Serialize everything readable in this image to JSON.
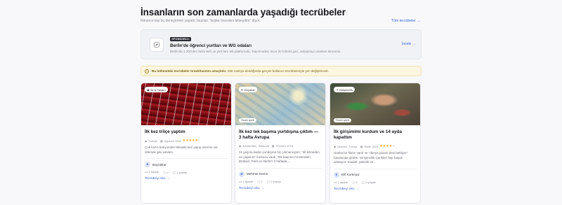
{
  "header": {
    "title": "İnsanların son zamanlarda yaşadığı tecrübeler",
    "subtitle": "Rimerce kişi bu deneyimleri yaşadı; bazıları \"keşke önceden bilseydim\" diyor.",
    "all_link": "Tüm tecrübeler →"
  },
  "sponsor": {
    "badge": "SPONSORLU",
    "title": "Berlin'de öğrenci yurtları ve WG odaları",
    "description": "Berlin'da 1.200'den fazla WG ve yurt fanı tek platformda. Taşınmadan önce 30 fotlarla gez, anlaşmayı uzaktan tamamla.",
    "link": "İncele →",
    "icon": "compass-icon"
  },
  "notice": {
    "icon": "info-icon",
    "bold": "Bu bölümdeki tecrübeler örnek/tanıtım amaçlıdır.",
    "text": " Site canlıya alındığında gerçek kullanıcı tecrübeleriyle yer değiştirecek."
  },
  "cards": [
    {
      "tag": "İlk İş Yaşam",
      "title": "İlk kez trilçe yaptım",
      "location": "Türkiye",
      "date": "Ağustos 2026",
      "rating": 5,
      "description": "Çok kazılı kanyondan Menalis kez yapıp üzerme sıtl dökmek gibi sanden",
      "author": "Bayraktar",
      "avatar": "B",
      "likes": "2 faydalı",
      "comments": "0",
      "saves": "1 yaşadı",
      "read": "Tecrübeyi oku →"
    },
    {
      "tag": "Seyahat",
      "example": "Örnek içerik",
      "title": "İlk kez tek başıma yurtdışına çıktım — 3 hafta Avrupa",
      "location": "Amsterdam, Hollanda",
      "date": "Temmuz 2016",
      "rating": 5,
      "description": "31 yaşına kadar yurtdışına hiç çıkmamıştım; \"dil bilmeden ne yaparım\" korkusu vardı. Tek başıma Amsterdam, Brüksel, Paris ve Berlin'i 3 haftada...",
      "author": "Mehmet Demir",
      "avatar": "M",
      "likes": "1 faydalı",
      "comments": "0",
      "saves": "0 yaşadı",
      "read": "Tecrübeyi oku →"
    },
    {
      "tag": "Girişimcilik",
      "example": "Örnek içerik",
      "title": "İlk girişimimi kurdum ve 14 ayda kapattım",
      "location": "İstanbul, Türkiye",
      "date": "Nisan 2023",
      "rating": 4,
      "description": "Harika bir fikrim vardı ve \"dünya pazarı beni bekliyor\" havasında girdim. Girişimcilik içerikleri hep başarı anlatıyor; maalaf, yabıdık ve...",
      "author": "Elif Korkmaz",
      "avatar": "E",
      "likes": "1 faydalı",
      "comments": "0",
      "saves": "0 yaşadı",
      "read": "Tecrübeyi oku →"
    }
  ],
  "colors": {
    "accent": "#3b64d6",
    "star": "#f0a81c",
    "notice_bg": "#fdf6e0"
  }
}
